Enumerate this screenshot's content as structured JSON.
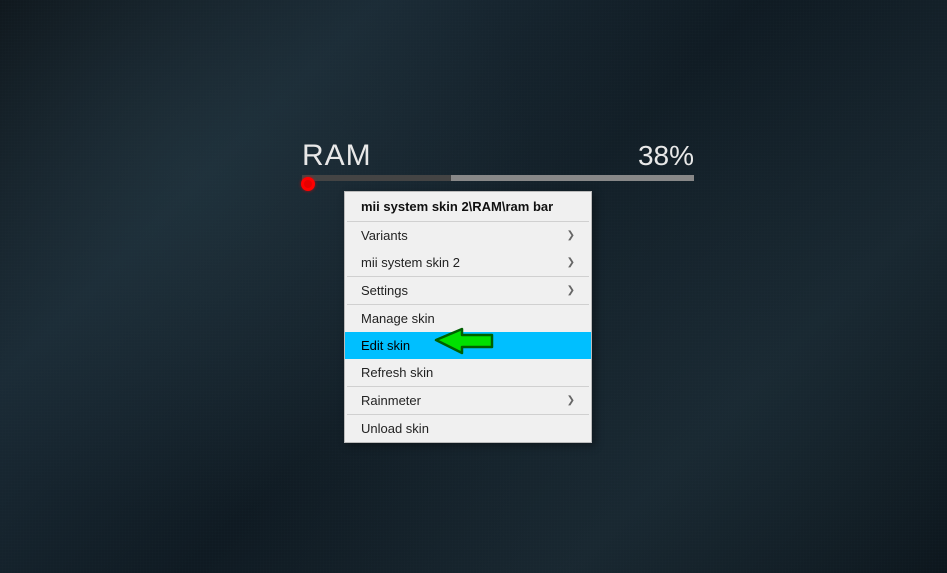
{
  "widget": {
    "title": "RAM",
    "percent_label": "38%",
    "percent_value": 38
  },
  "menu": {
    "header": "mii system skin 2\\RAM\\ram bar",
    "items": {
      "variants": {
        "label": "Variants",
        "has_submenu": true
      },
      "mii_system": {
        "label": "mii system skin 2",
        "has_submenu": true
      },
      "settings": {
        "label": "Settings",
        "has_submenu": true
      },
      "manage": {
        "label": "Manage skin",
        "has_submenu": false
      },
      "edit": {
        "label": "Edit skin",
        "has_submenu": false
      },
      "refresh": {
        "label": "Refresh skin",
        "has_submenu": false
      },
      "rainmeter": {
        "label": "Rainmeter",
        "has_submenu": true
      },
      "unload": {
        "label": "Unload skin",
        "has_submenu": false
      }
    },
    "highlighted": "edit"
  }
}
